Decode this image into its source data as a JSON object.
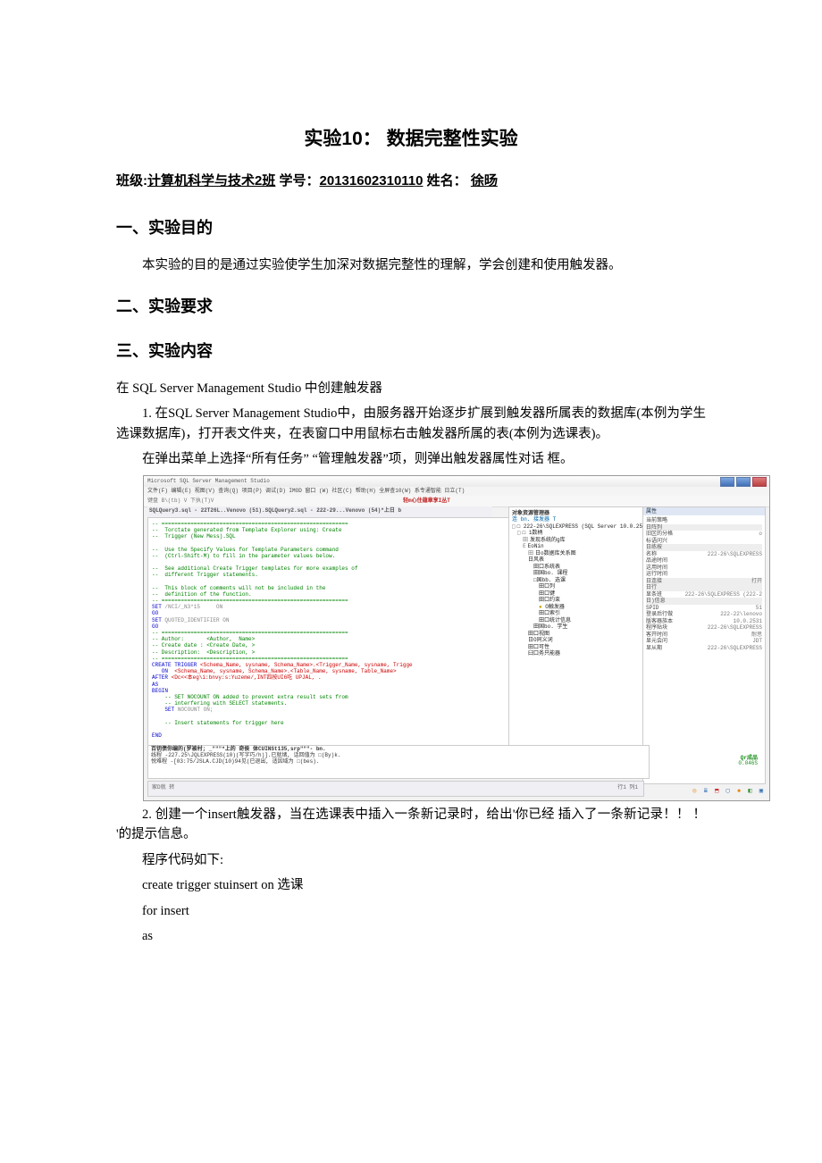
{
  "title": "实验10：  数据完整性实验",
  "meta": {
    "class_label": "班级:",
    "class_value": "计算机科学与技术2班",
    "id_label": " 学号：",
    "id_value": "20131602310110",
    "name_label": " 姓名：  ",
    "name_value": "徐旸"
  },
  "sections": {
    "s1_heading": "一、实验目的",
    "s1_p1": "本实验的目的是通过实验使学生加深对数据完整性的理解，学会创建和使用触发器。",
    "s2_heading": "二、实验要求",
    "s3_heading": "三、实验内容",
    "s3_p1": "在 SQL Server Management Studio 中创建触发器",
    "s3_item1": "1.   在SQL Server Management Studio中，由服务器开始逐步扩展到触发器所属表的数据库(本例为学生选课数据库)，打开表文件夹，在表窗口中用鼠标右击触发器所属的表(本例为选课表)。",
    "s3_item1b": "在弹出菜单上选择“所有任务”   “管理触发器”项，则弹出触发器属性对话 框。",
    "s3_item2": "2.   创建一个insert触发器，当在选课表中插入一条新记录时，给出'你已经 插入了一条新记录！！ ！ '的提示信息。",
    "s3_code_intro": "程序代码如下:",
    "s3_code_l1": "create trigger stuinsert on 选课",
    "s3_code_l2": "for insert",
    "s3_code_l3": "as"
  },
  "ssms": {
    "title": "Microsoft SQL Server Management Studio",
    "menubar": "文件(F) 编辑(E) 视图(V) 查询(Q) 项目(P) 调试(D) IMOD 窗口  (W) 社区(C) 帮助(H) 全屏查10(W) 系专通智能  日立(T)",
    "toolbar_left": "键盘 B\\(tb)                     V 下执(T)V",
    "toolbar_red": "轻m心住蕴章享I丛T",
    "tabs": "SQLQuery3.sql - 22T26L..Venovo (51).SQLQuery2.sql - 222-29...Venovo (54)*上日 b",
    "editor": {
      "l01": "-- ==========================================================",
      "l02": "--  Torctate generated from Template Explorer using: Create",
      "l03": "--  Trigger (New Mess).SQL",
      "l04": "",
      "l05": "--  Use the Specify Values for Template Parameters command",
      "l06": "--  (Ctrl-Shift-M) to fill in the parameter values below.",
      "l07": "",
      "l08": "--  See additional Create Trigger templates for more examples of",
      "l09": "--  different Trigger statements.",
      "l10": "",
      "l11": "--  This block of comments will not be included in the",
      "l12": "--  definition of the function.",
      "l13": "-- ==========================================================",
      "l14a": "SET ",
      "l14b": "/NCI/_N3*15     ON",
      "l15": "GO",
      "l16a": "SET ",
      "l16b": "QUOTED_IDENTIFIER ON",
      "l17": "GO",
      "l18": "-- ==========================================================",
      "l19": "-- Author:       <Author,  Name>",
      "l20": "-- Create date : <Create Date, >",
      "l21": "-- Description:  <Description, >",
      "l22": "-- ==========================================================",
      "l23a": "CREATE TRIGGER ",
      "l23b": "<Schema_Name, sysname, Schema_Name>.<Trigger_Name, sysname, Trigge",
      "l24a": "   ON  ",
      "l24b": "<Schema_Name, sysname, Schema_Name>.<Table_Name, sysname, Table_Name>",
      "l25a": "AFTER ",
      "l25b": "<Dc<<本eg\\i:bnvy:s:Yuzeme/,INT四按UI6吃 UPJAL, .",
      "l26": "AS",
      "l27": "BEGIN",
      "l28": "    -- SET NOCOUNT ON added to prevent extra result sets from",
      "l29": "    -- interfering with SELECT statements.",
      "l30a": "    SET ",
      "l30b": "NOCOUNT ON;",
      "l31": "",
      "l32": "    -- Insert statements for trigger here",
      "l33": "",
      "l34": "END"
    },
    "objexp": {
      "header": "对象资源管理器",
      "connect": "连 bn.  接发器  T",
      "server": "□ 222-26\\SQLEXPRESS (SQL Server 10.0.2531 - 222-26\\L",
      "n1": "□ 1数柄",
      "n2": "发现系统的g库",
      "n3": "EoNin",
      "n4": "日o数据库关系图",
      "n5": "日风表",
      "n6": "田口系统表",
      "n7": "田国bo. 课程",
      "n8": "□国bb. 选课",
      "n9": "田口列",
      "n10": "田口键",
      "n11": "田口约束",
      "n12": "O触发器",
      "n13": "田口索引",
      "n14": "田口统计信息",
      "n15": "田国bo. 学生",
      "n16": "田口视图",
      "n17": "日O同义词",
      "n18": "田口可性",
      "n19": "臼口务只能器"
    },
    "props": {
      "header": "属性",
      "sub": "当前策略",
      "cat1": "日阵列",
      "r1k": "旧区的分格",
      "r1v": "o",
      "r2k": "标语问兴",
      "cat2": "日练按",
      "r3k": "名称",
      "r3v": "222-26\\SQLEXPRESS",
      "r4k": "品途时间",
      "r5k": "这用时间",
      "r6k": "运行时间",
      "cat3": "日连接",
      "r7k": "打开",
      "cat4": "日行",
      "r8k": "显条班",
      "r8v": "222-26\\SQLEXPRESS (222-2",
      "cat5": "日)信息",
      "r9k": "SPID",
      "r9v": "51",
      "r10k": "登录后行做",
      "r10v": "222-22\\lenovo",
      "r11k": "版客器族本",
      "r11v": "10.0.2531",
      "r12k": "程序贴块",
      "r12v": "222-26\\SQLEXPRESS",
      "r13k": "客开时间",
      "r13v": "耐思",
      "r14k": "显元会问",
      "r14v": "JDT",
      "r15k": "显从期",
      "r15v": "222-26\\SQLEXPRESS",
      "foot_label": "Qr成品",
      "foot_time": "0.046S"
    },
    "results": {
      "l1": "百钥债你编的(罗被村; _\"\"\"*上的 奇侯 体CUINSt135,srp\"\"\"- bn.",
      "l2": "线程 -227.25\\JQLEXPRESS(10)(写字巧/h)].已就绪, 话回值为 □(By)k.",
      "l3": "悦难程 -[03:75/JSLA.CJD(10)94见(已退出, 适因域为 □(bes)."
    },
    "status_left": "家D就  转",
    "status_right": "行1       列1"
  }
}
